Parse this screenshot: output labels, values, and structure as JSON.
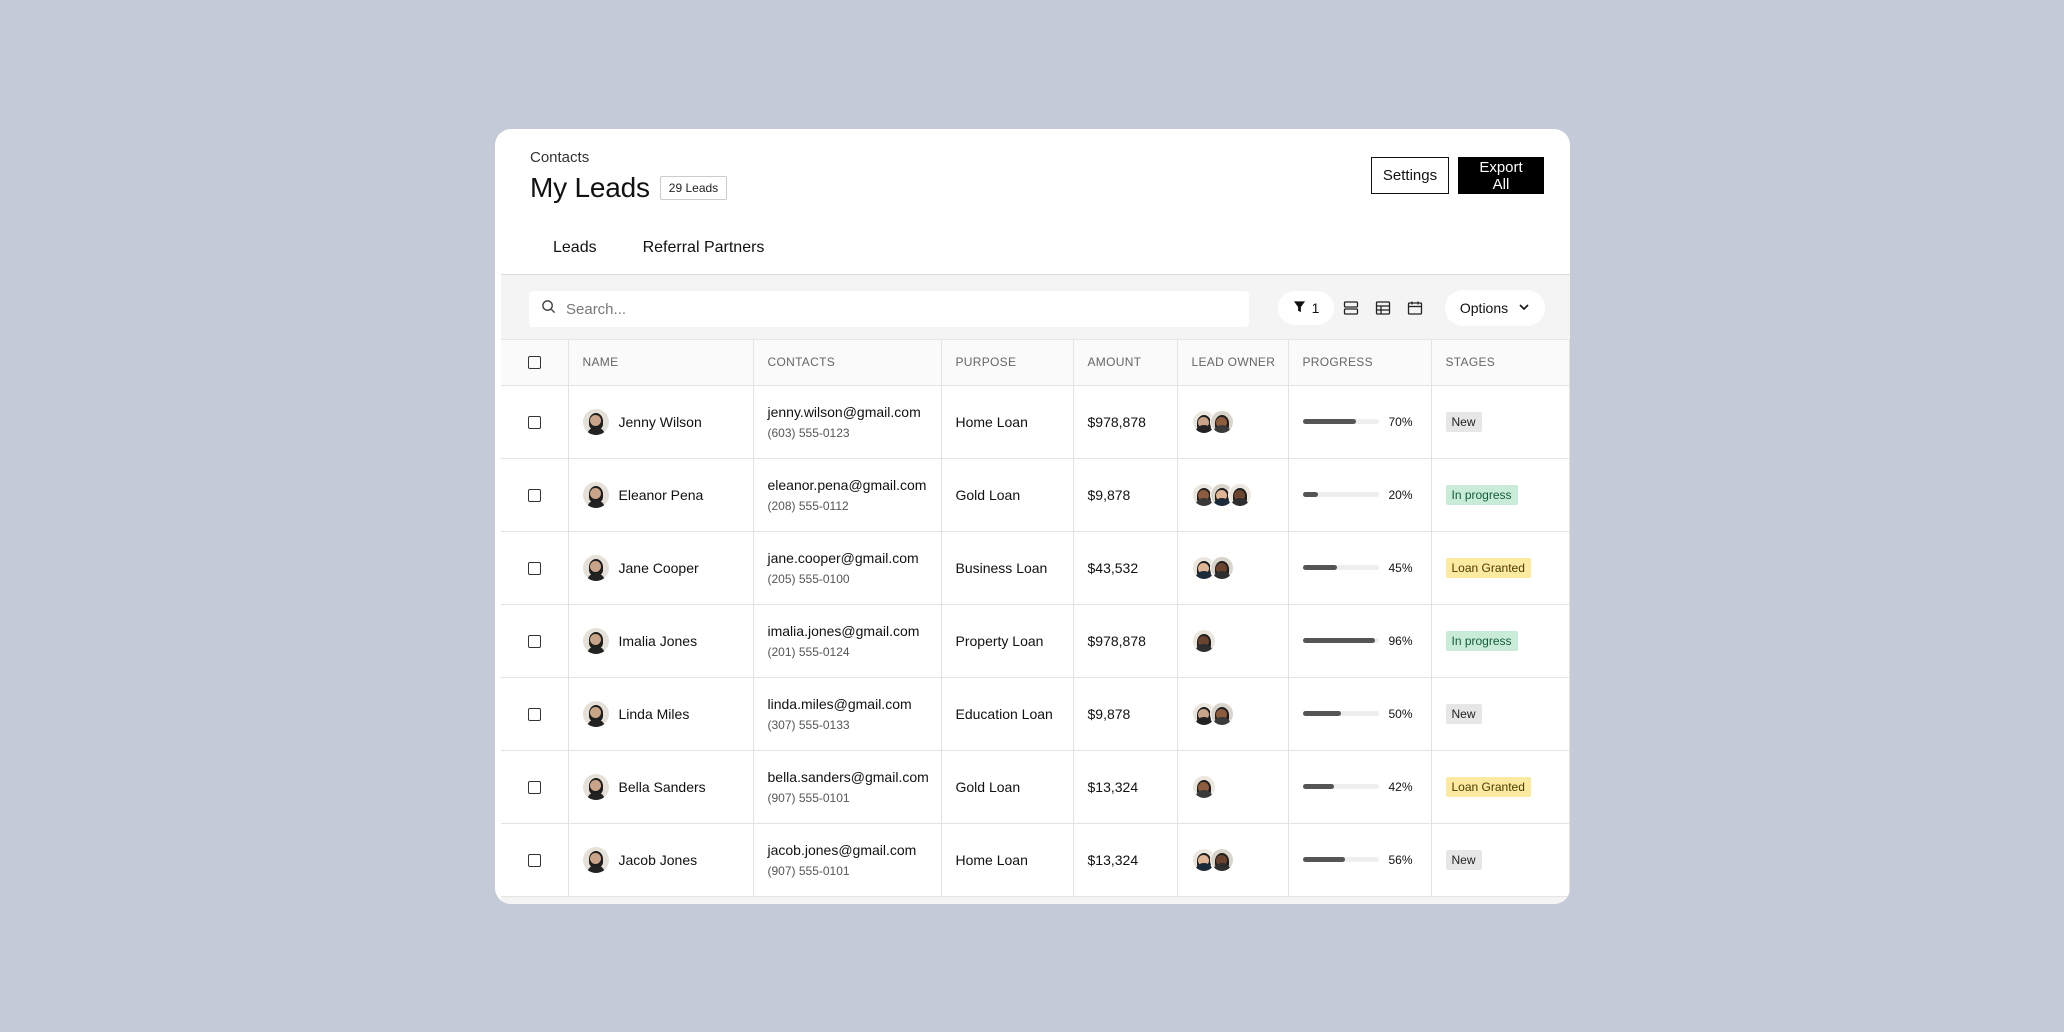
{
  "header": {
    "breadcrumb": "Contacts",
    "title": "My Leads",
    "lead_count": "29 Leads",
    "settings_label": "Settings",
    "export_label": "Export All"
  },
  "tabs": [
    {
      "label": "Leads",
      "active": true
    },
    {
      "label": "Referral Partners",
      "active": false
    }
  ],
  "toolbar": {
    "search_placeholder": "Search...",
    "filter_count": "1",
    "options_label": "Options"
  },
  "table": {
    "columns": [
      "NAME",
      "CONTACTS",
      "PURPOSE",
      "AMOUNT",
      "LEAD OWNER",
      "PROGRESS",
      "STAGES"
    ],
    "rows": [
      {
        "name": "Jenny Wilson",
        "email": "jenny.wilson@gmail.com",
        "phone": "(603) 555-0123",
        "purpose": "Home Loan",
        "amount": "$978,878",
        "owners": 2,
        "progress": 70,
        "progress_label": "70%",
        "stage": "New",
        "stage_type": "new"
      },
      {
        "name": "Eleanor Pena",
        "email": "eleanor.pena@gmail.com",
        "phone": "(208) 555-0112",
        "purpose": "Gold Loan",
        "amount": "$9,878",
        "owners": 3,
        "progress": 20,
        "progress_label": "20%",
        "stage": "In progress",
        "stage_type": "progress"
      },
      {
        "name": "Jane Cooper",
        "email": "jane.cooper@gmail.com",
        "phone": "(205) 555-0100",
        "purpose": "Business Loan",
        "amount": "$43,532",
        "owners": 2,
        "progress": 45,
        "progress_label": "45%",
        "stage": "Loan Granted",
        "stage_type": "granted"
      },
      {
        "name": "Imalia Jones",
        "email": "imalia.jones@gmail.com",
        "phone": "(201) 555-0124",
        "purpose": "Property Loan",
        "amount": "$978,878",
        "owners": 1,
        "progress": 96,
        "progress_label": "96%",
        "stage": "In progress",
        "stage_type": "progress"
      },
      {
        "name": "Linda Miles",
        "email": "linda.miles@gmail.com",
        "phone": "(307) 555-0133",
        "purpose": "Education Loan",
        "amount": "$9,878",
        "owners": 2,
        "progress": 50,
        "progress_label": "50%",
        "stage": "New",
        "stage_type": "new"
      },
      {
        "name": "Bella Sanders",
        "email": "bella.sanders@gmail.com",
        "phone": "(907) 555-0101",
        "purpose": "Gold Loan",
        "amount": "$13,324",
        "owners": 1,
        "progress": 42,
        "progress_label": "42%",
        "stage": "Loan Granted",
        "stage_type": "granted"
      },
      {
        "name": "Jacob Jones",
        "email": "jacob.jones@gmail.com",
        "phone": "(907) 555-0101",
        "purpose": "Home Loan",
        "amount": "$13,324",
        "owners": 2,
        "progress": 56,
        "progress_label": "56%",
        "stage": "New",
        "stage_type": "new"
      }
    ]
  }
}
